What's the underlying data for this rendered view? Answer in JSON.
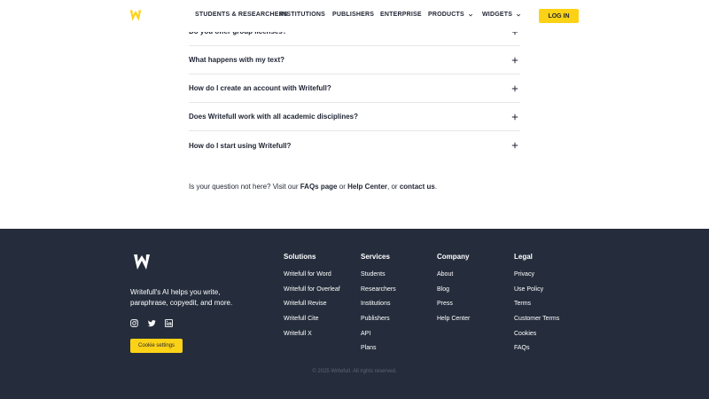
{
  "header": {
    "nav": [
      {
        "label": "STUDENTS & RESEARCHERS",
        "has_dropdown": false
      },
      {
        "label": "INSTITUTIONS",
        "has_dropdown": false
      },
      {
        "label": "PUBLISHERS",
        "has_dropdown": false
      },
      {
        "label": "ENTERPRISE",
        "has_dropdown": false
      },
      {
        "label": "PRODUCTS",
        "has_dropdown": true
      },
      {
        "label": "WIDGETS",
        "has_dropdown": true
      }
    ],
    "login_label": "LOG IN"
  },
  "faq": {
    "items": [
      {
        "question": "Do you offer group licenses?"
      },
      {
        "question": "What happens with my text?"
      },
      {
        "question": "How do I create an account with Writefull?"
      },
      {
        "question": "Does Writefull work with all academic disciplines?"
      },
      {
        "question": "How do I start using Writefull?"
      }
    ],
    "help": {
      "prefix": "Is your question not here? Visit our",
      "faqs_link": "FAQs page",
      "or1": "or",
      "help_link": "Help Center",
      "or2": ", or",
      "contact_link": "contact us",
      "suffix": "."
    }
  },
  "footer": {
    "tagline": "Writefull's AI helps you write, paraphrase, copyedit, and more.",
    "cookie_label": "Cookie settings",
    "columns": [
      {
        "title": "Solutions",
        "links": [
          "Writefull for Word",
          "Writefull for Overleaf",
          "Writefull Revise",
          "Writefull Cite",
          "Writefull X"
        ]
      },
      {
        "title": "Services",
        "links": [
          "Students",
          "Researchers",
          "Institutions",
          "Publishers",
          "API",
          "Plans"
        ]
      },
      {
        "title": "Company",
        "links": [
          "About",
          "Blog",
          "Press",
          "Help Center"
        ]
      },
      {
        "title": "Legal",
        "links": [
          "Privacy",
          "Use Policy",
          "Terms",
          "Customer Terms",
          "Cookies",
          "FAQs"
        ]
      }
    ],
    "copyright": "© 2025 Writefull. All rights reserved.",
    "social": [
      "instagram-icon",
      "twitter-icon",
      "linkedin-icon"
    ]
  },
  "colors": {
    "accent": "#fcd217",
    "footer_bg": "#252d3c",
    "text": "#1f2433"
  }
}
